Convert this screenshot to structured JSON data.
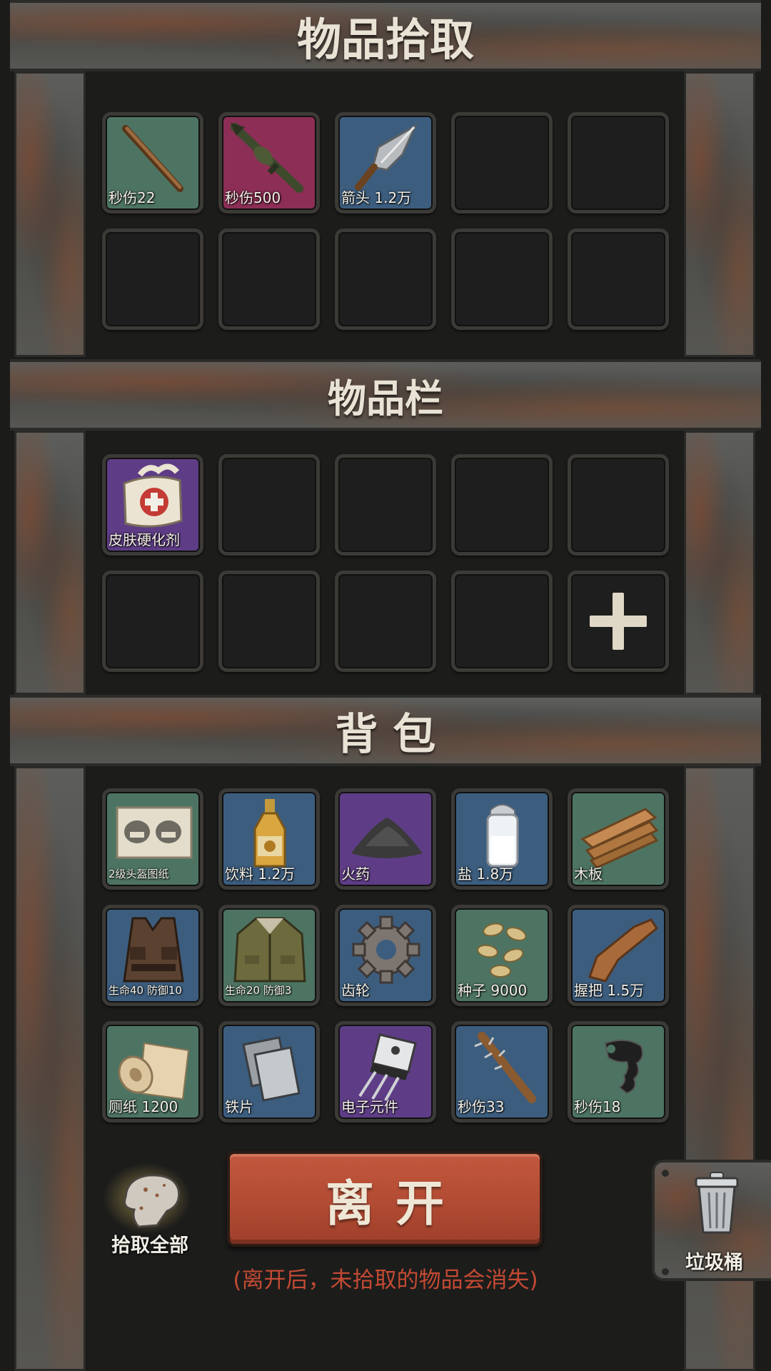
{
  "pickup": {
    "title": "物品拾取",
    "items": [
      {
        "label": "秒伤22",
        "color": "green",
        "icon": "wooden-stick-icon"
      },
      {
        "label": "秒伤500",
        "color": "crimson",
        "icon": "rocket-launcher-icon"
      },
      {
        "label": "箭头 1.2万",
        "color": "blue",
        "icon": "arrowhead-icon"
      }
    ]
  },
  "hotbar": {
    "title": "物品栏",
    "items": [
      {
        "label": "皮肤硬化剂",
        "color": "purple",
        "icon": "medical-bag-icon"
      }
    ],
    "add_icon": "plus-icon"
  },
  "backpack": {
    "title": "背 包",
    "items": [
      {
        "label": "2级头盔图纸",
        "color": "green",
        "icon": "helmet-blueprint-icon"
      },
      {
        "label": "饮料 1.2万",
        "color": "blue",
        "icon": "bottle-icon"
      },
      {
        "label": "火药",
        "color": "purple",
        "icon": "gunpowder-icon"
      },
      {
        "label": "盐 1.8万",
        "color": "blue",
        "icon": "salt-shaker-icon"
      },
      {
        "label": "木板",
        "color": "green",
        "icon": "wooden-planks-icon"
      },
      {
        "label": "生命40 防御10",
        "color": "blue",
        "icon": "tactical-vest-icon"
      },
      {
        "label": "生命20 防御3",
        "color": "green",
        "icon": "jacket-icon"
      },
      {
        "label": "齿轮",
        "color": "blue",
        "icon": "gear-icon"
      },
      {
        "label": "种子 9000",
        "color": "green",
        "icon": "seeds-icon"
      },
      {
        "label": "握把 1.5万",
        "color": "blue",
        "icon": "gun-stock-icon"
      },
      {
        "label": "厕纸 1200",
        "color": "green",
        "icon": "toilet-paper-icon"
      },
      {
        "label": "铁片",
        "color": "blue",
        "icon": "iron-sheet-icon"
      },
      {
        "label": "电子元件",
        "color": "purple",
        "icon": "electronic-component-icon"
      },
      {
        "label": "秒伤33",
        "color": "blue",
        "icon": "spiked-bat-icon"
      },
      {
        "label": "秒伤18",
        "color": "green",
        "icon": "brass-knuckles-icon"
      }
    ]
  },
  "actions": {
    "pick_all_label": "拾取全部",
    "leave_label": "离开",
    "warning": "(离开后，未拾取的物品会消失)",
    "trash_label": "垃圾桶"
  }
}
